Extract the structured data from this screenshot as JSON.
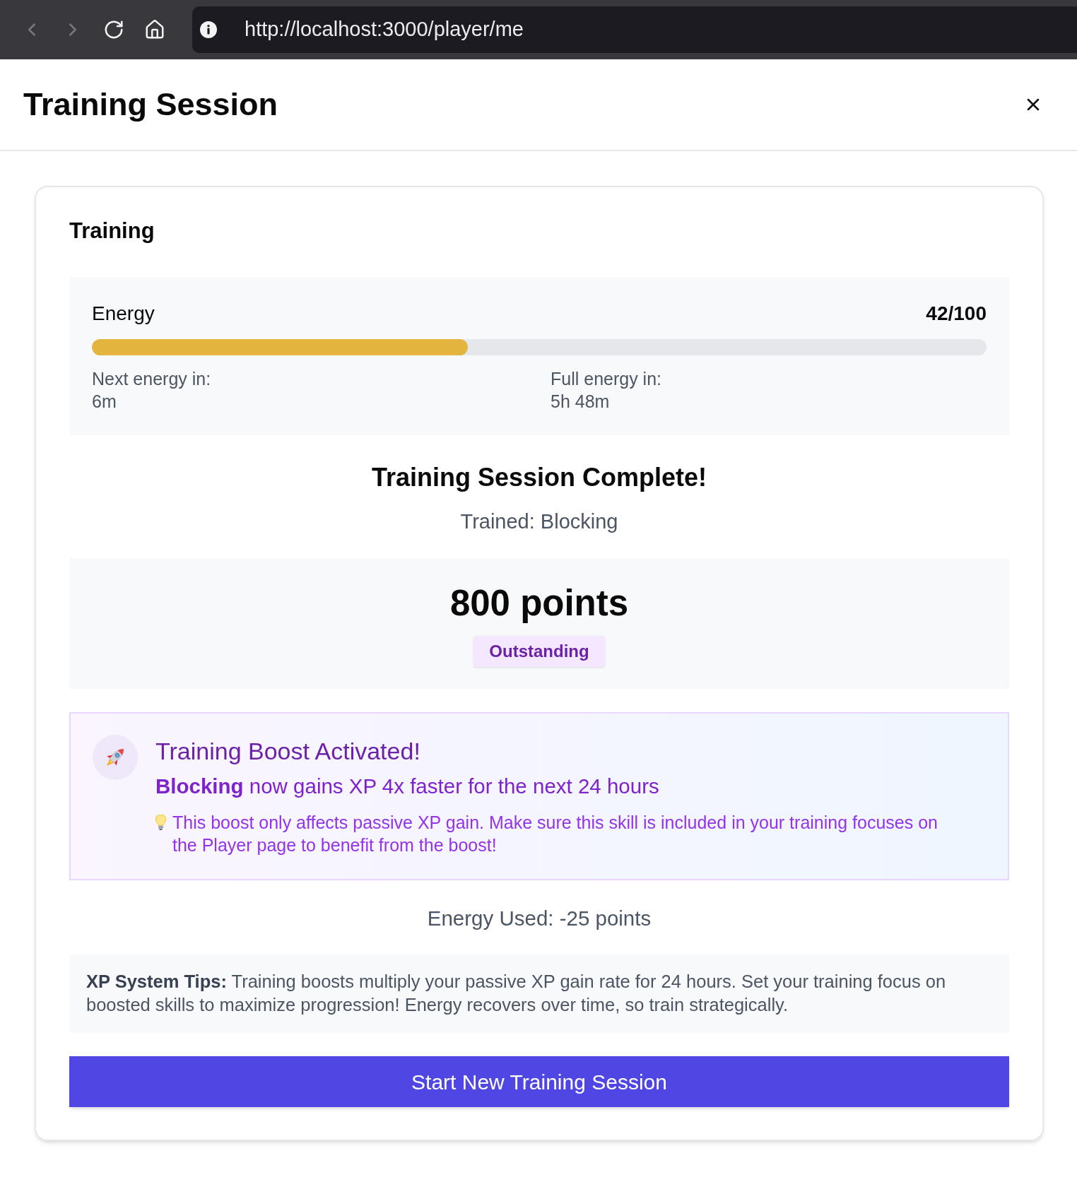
{
  "browser": {
    "nav_buttons": [
      {
        "kind": "back",
        "disabled": true
      },
      {
        "kind": "forward",
        "disabled": true
      },
      {
        "kind": "reload",
        "disabled": false
      },
      {
        "kind": "home",
        "disabled": false
      }
    ],
    "url": "http://localhost:3000/player/me"
  },
  "header": {
    "title": "Training Session"
  },
  "training": {
    "title": "Training",
    "energy": {
      "label": "Energy",
      "reading": "42/100",
      "level": 0.42,
      "timers": [
        {
          "label": "Next energy in:",
          "value": "6m"
        },
        {
          "label": "Full energy in:",
          "value": "5h 48m"
        }
      ]
    },
    "result": {
      "title": "Training Session Complete!",
      "trained": "Trained: Blocking",
      "points": "800 points",
      "rating": "Outstanding"
    },
    "boost": {
      "title": "Training Boost Activated!",
      "message": "**Blocking** now gains XP 4x faster for the next 24 hours",
      "note": "This boost only affects passive XP gain. Make sure this skill is included in your training focuses on the Player page to benefit from the boost!"
    },
    "energy_used": "Energy Used: -25 points",
    "tips": "**XP System Tips:** Training boosts multiply your passive XP gain rate for 24 hours. Set your training focus on boosted skills to maximize progression! Energy recovers over time, so train strategically.",
    "button": "Start New Training Session"
  }
}
